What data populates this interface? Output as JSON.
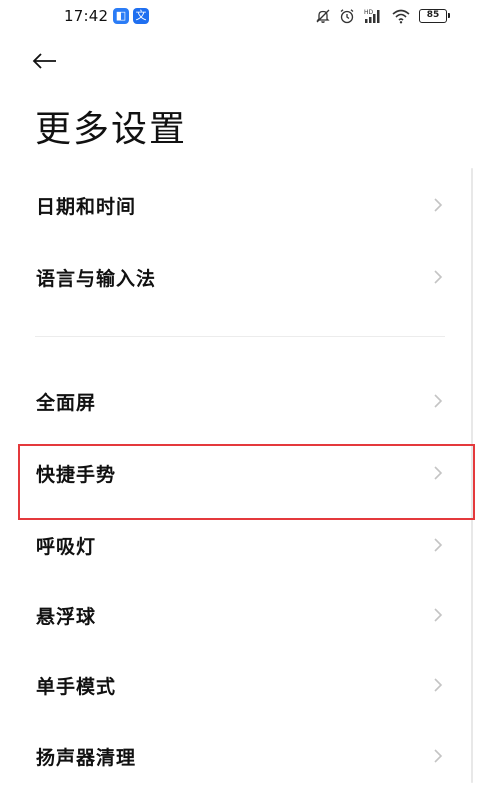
{
  "status_bar": {
    "time": "17:42",
    "app_icons": [
      "blue-square-icon",
      "translate-icon"
    ],
    "app_icon_glyphs": [
      "◧",
      "文"
    ],
    "right_icons": [
      "bell-off-icon",
      "alarm-icon",
      "hd-signal-icon",
      "wifi-icon"
    ],
    "battery": "85"
  },
  "header": {
    "back_icon": "back-arrow-icon",
    "title": "更多设置"
  },
  "settings": {
    "items": [
      {
        "label": "日期和时间"
      },
      {
        "label": "语言与输入法"
      },
      {
        "label": "全面屏"
      },
      {
        "label": "快捷手势"
      },
      {
        "label": "呼吸灯"
      },
      {
        "label": "悬浮球"
      },
      {
        "label": "单手模式"
      },
      {
        "label": "扬声器清理"
      }
    ],
    "chevron_icon": "chevron-right-icon"
  },
  "colors": {
    "highlight": "#e4393c",
    "chevron": "#c4c4c4",
    "text": "#111111"
  }
}
